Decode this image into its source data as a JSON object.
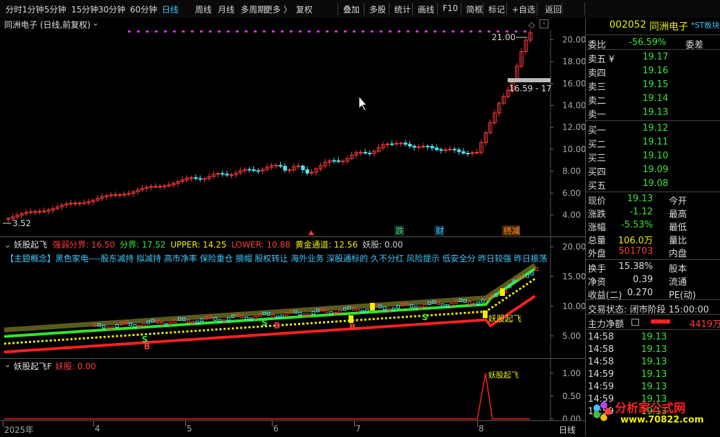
{
  "toolbar": {
    "items": [
      "分时",
      "1分钟",
      "5分钟",
      "15分钟",
      "30分钟",
      "60分钟",
      "日线",
      "周线",
      "月线",
      "多周期",
      "更多 〉",
      "复权",
      "叠加",
      "多股",
      "统计",
      "画线",
      "F10",
      "简框",
      "标记",
      "+自选",
      "返回"
    ],
    "active_index": 6
  },
  "main_chart": {
    "title": "同洲电子 (日线,前复权)",
    "title_icon": "chevron-down-icon",
    "price_high_label": "21.00",
    "price_low_label": "3.52",
    "range_label": "16.59 - 17",
    "y_ticks": [
      "20.00",
      "18.00",
      "16.00",
      "14.00",
      "12.00",
      "10.00",
      "8.00",
      "6.00",
      "4.00"
    ],
    "events": [
      "跌",
      "财",
      "终减"
    ]
  },
  "indicator1": {
    "name": "妖股起飞",
    "values": [
      {
        "label": "强弱分界:",
        "value": "16.50",
        "color": "#ff3b3b"
      },
      {
        "label": "分界:",
        "value": "17.52",
        "color": "#35e835"
      },
      {
        "label": "UPPER:",
        "value": "14.25",
        "color": "#f0f000"
      },
      {
        "label": "LOWER:",
        "value": "10.88",
        "color": "#ff3b3b"
      },
      {
        "label": "黄金通道:",
        "value": "12.56",
        "color": "#f0f000"
      },
      {
        "label": "妖股:",
        "value": "0.00",
        "color": "#d0d0d0"
      }
    ],
    "concepts": "【主题概念】黑色家电----股东减持 拟减持 高市净率 保险重仓 摘帽 股权转让 海外业务 深股通标的 久不分红 风险提示 低安全分 昨日较强 昨日振荡",
    "y_ticks": [
      "20.00",
      "15.00",
      "10.00",
      "5.00"
    ],
    "tag": "妖股起飞"
  },
  "indicator2": {
    "name": "妖股起飞F",
    "value_label": "妖股:",
    "value": "0.00",
    "y_ticks": [
      "1.00",
      "0.50",
      "0.00"
    ],
    "tag": "妖股起飞"
  },
  "x_axis": [
    "2025年",
    "4",
    "5",
    "6",
    "7",
    "8"
  ],
  "x_axis_mode": "日线",
  "quote": {
    "code": "002052",
    "name": "同洲电子",
    "board": "*ST板块",
    "wei_bi_label": "委比",
    "wei_bi": "-56.59%",
    "wei_cha_label": "委差",
    "sell": [
      {
        "label": "卖五",
        "flag": "¥",
        "price": "19.17"
      },
      {
        "label": "卖四",
        "flag": "",
        "price": "19.16"
      },
      {
        "label": "卖三",
        "flag": "",
        "price": "19.15"
      },
      {
        "label": "卖二",
        "flag": "",
        "price": "19.14"
      },
      {
        "label": "卖一",
        "flag": "",
        "price": "19.13"
      }
    ],
    "buy": [
      {
        "label": "买一",
        "price": "19.12"
      },
      {
        "label": "买二",
        "price": "19.11"
      },
      {
        "label": "买三",
        "price": "19.10"
      },
      {
        "label": "买四",
        "price": "19.09"
      },
      {
        "label": "买五",
        "price": "19.08"
      }
    ],
    "stats": [
      {
        "l1": "现价",
        "v1": "19.13",
        "c1": "#35e835",
        "l2": "今开"
      },
      {
        "l1": "涨跌",
        "v1": "-1.12",
        "c1": "#35e835",
        "l2": "最高"
      },
      {
        "l1": "涨幅",
        "v1": "-5.53%",
        "c1": "#35e835",
        "l2": "最低"
      },
      {
        "l1": "总量",
        "v1": "106.0万",
        "c1": "#f0f000",
        "l2": "量比"
      },
      {
        "l1": "外盘",
        "v1": "501703",
        "c1": "#ff3b3b",
        "l2": "内盘"
      }
    ],
    "stats2": [
      {
        "l1": "换手",
        "v1": "15.38%",
        "l2": "股本"
      },
      {
        "l1": "净资",
        "v1": "0.39",
        "l2": "流通"
      },
      {
        "l1": "收益(二)",
        "v1": "0.270",
        "l2": "PE(动)"
      }
    ],
    "trade_status": "交易状态: 闭市阶段 15:00:00",
    "main_flow_label": "主力净额",
    "main_flow_value": "4419万",
    "ticks": [
      {
        "time": "14:58",
        "price": "19.13"
      },
      {
        "time": "14:58",
        "price": "19.13"
      },
      {
        "time": "14:58",
        "price": "19.13"
      },
      {
        "time": "14:59",
        "price": "19.13"
      },
      {
        "time": "14:59",
        "price": "19.13"
      },
      {
        "time": "14:59",
        "price": "19.13"
      },
      {
        "time": "14:59",
        "price": "19.13"
      }
    ]
  },
  "watermark": {
    "title": "分析家公式网",
    "url": "www.70822.com"
  }
}
